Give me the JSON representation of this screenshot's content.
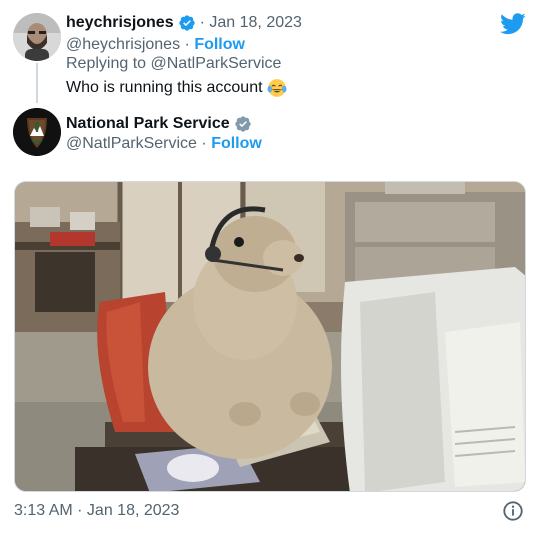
{
  "reply": {
    "name": "heychrisjones",
    "date": "Jan 18, 2023",
    "handle": "@heychrisjones",
    "follow_label": "Follow",
    "replying_to": "Replying to @NatlParkService",
    "text": "Who is running this account",
    "emoji": "face-with-tears-of-joy-icon"
  },
  "author": {
    "name": "National Park Service",
    "handle": "@NatlParkService",
    "follow_label": "Follow"
  },
  "tweet": {
    "timestamp": "3:13 AM · Jan 18, 2023"
  },
  "colors": {
    "accent": "#1d9bf0",
    "secondary_text": "#536471",
    "primary_text": "#0f1419"
  }
}
